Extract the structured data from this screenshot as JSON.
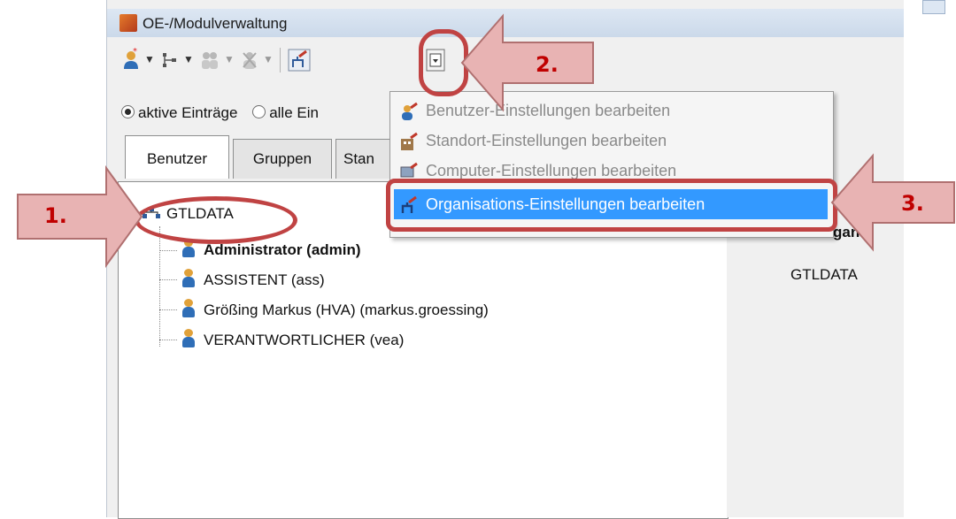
{
  "window": {
    "title": "OE-/Modulverwaltung"
  },
  "toolbar": {
    "icons": [
      "add-user-icon",
      "org-tree-icon",
      "group-icon",
      "delete-icon",
      "org-settings-icon",
      "dropdown-icon"
    ]
  },
  "filter": {
    "active_label": "aktive Einträge",
    "all_label": "alle Ein",
    "selected": "aktive Einträge"
  },
  "tabs": [
    {
      "label": "Benutzer",
      "active": true
    },
    {
      "label": "Gruppen",
      "active": false
    },
    {
      "label": "Stan",
      "active": false
    }
  ],
  "tree": {
    "root": "GTLDATA",
    "children": [
      {
        "label": "Administrator (admin)",
        "bold": true
      },
      {
        "label": "ASSISTENT (ass)",
        "bold": false
      },
      {
        "label": "Größing Markus (HVA) (markus.groessing)",
        "bold": false
      },
      {
        "label": "VERANTWORTLICHER (vea)",
        "bold": false
      }
    ]
  },
  "right_pane": {
    "header_fragment": "ganı",
    "value": "GTLDATA"
  },
  "menu": {
    "items": [
      {
        "label": "Benutzer-Einstellungen bearbeiten",
        "icon": "user-settings-icon",
        "enabled": false
      },
      {
        "label": "Standort-Einstellungen bearbeiten",
        "icon": "location-settings-icon",
        "enabled": false
      },
      {
        "label": "Computer-Einstellungen bearbeiten",
        "icon": "computer-settings-icon",
        "enabled": false
      },
      {
        "label": "Organisations-Einstellungen bearbeiten",
        "icon": "organisation-settings-icon",
        "enabled": true,
        "selected": true
      }
    ]
  },
  "callouts": {
    "step1": "1.",
    "step2": "2.",
    "step3": "3."
  },
  "colors": {
    "highlight": "#c04343",
    "selection": "#3399ff",
    "callout_text": "#c00000",
    "arrow_fill": "#e8b3b3"
  }
}
